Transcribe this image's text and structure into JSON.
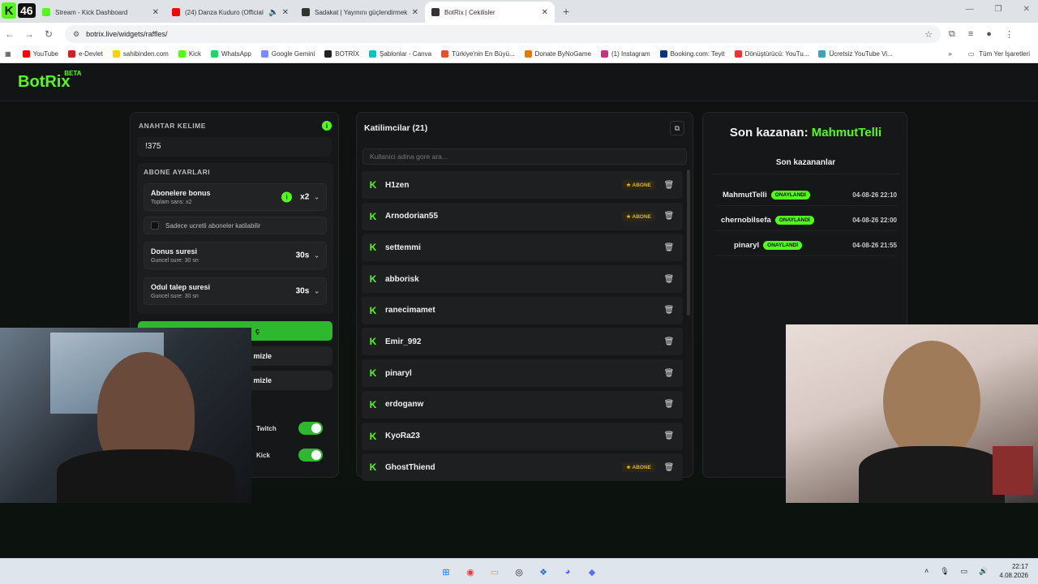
{
  "browser": {
    "badge_number": "46",
    "tabs": [
      {
        "title": "Stream - Kick Dashboard",
        "color": "#53fc18"
      },
      {
        "title": "(24) Danza Kuduro (Official",
        "color": "#ff0000"
      },
      {
        "title": "Sadakat | Yayınını güçlendirmek",
        "color": "#333333"
      },
      {
        "title": "BotRix | Cekilisler",
        "color": "#333333"
      }
    ],
    "url": "botrix.live/widgets/raffles/",
    "bookmarks": [
      {
        "label": "YouTube",
        "color": "#ff0000"
      },
      {
        "label": "e-Devlet",
        "color": "#cc2222"
      },
      {
        "label": "sahibinden.com",
        "color": "#ffd200"
      },
      {
        "label": "Kick",
        "color": "#53fc18"
      },
      {
        "label": "WhatsApp",
        "color": "#25d366"
      },
      {
        "label": "Google Gemini",
        "color": "#7b8cff"
      },
      {
        "label": "BOTRİX",
        "color": "#222222"
      },
      {
        "label": "Şablonlar - Canva",
        "color": "#00c4cc"
      },
      {
        "label": "Türkiye'nin En Büyü...",
        "color": "#e0532b"
      },
      {
        "label": "Donate ByNoGame",
        "color": "#e07b00"
      },
      {
        "label": "(1) Instagram",
        "color": "#c13584"
      },
      {
        "label": "Booking.com: Teyit",
        "color": "#003580"
      },
      {
        "label": "Dönüştürücü: YouTu...",
        "color": "#e53935"
      },
      {
        "label": "Ücretsiz YouTube Vi...",
        "color": "#3fa1b5"
      }
    ],
    "all_bookmarks": "Tüm Yer İşaretleri"
  },
  "app": {
    "brand": "BotRix",
    "brand_tag": "BETA"
  },
  "settings": {
    "keyword_label": "ANAHTAR KELIME",
    "keyword_value": "!375",
    "sub_settings_label": "ABONE AYARLARI",
    "sub_bonus_title": "Abonelere bonus",
    "sub_bonus_sub": "Toplam sans: x2",
    "sub_bonus_value": "x2",
    "sub_only_label": "Sadece ucretli aboneler katilabilir",
    "duration_title": "Donus suresi",
    "duration_sub": "Guncel sure: 30 sn",
    "duration_value": "30s",
    "claim_title": "Odul talep suresi",
    "claim_sub": "Guncel sure: 30 sn",
    "claim_value": "30s",
    "primary_button": "ç",
    "button_2": "mizle",
    "button_3": "mizle",
    "toggle_twitch": "Twitch",
    "toggle_kick": "Kick"
  },
  "participants": {
    "header": "Katilimcilar (21)",
    "search_placeholder": "Kullanici adina gore ara...",
    "badge_label": "ABONE",
    "list": [
      {
        "name": "H1zen",
        "sub": true
      },
      {
        "name": "Arnodorian55",
        "sub": true
      },
      {
        "name": "settemmi",
        "sub": false
      },
      {
        "name": "abborisk",
        "sub": false
      },
      {
        "name": "ranecimamet",
        "sub": false
      },
      {
        "name": "Emir_992",
        "sub": false
      },
      {
        "name": "pinaryl",
        "sub": false
      },
      {
        "name": "erdoganw",
        "sub": false
      },
      {
        "name": "KyoRa23",
        "sub": false
      },
      {
        "name": "GhostThiend",
        "sub": true
      }
    ]
  },
  "winners": {
    "last_label": "Son kazanan:",
    "last_name": "MahmutTelli",
    "list_header": "Son kazananlar",
    "badge_label": "ONAYLANDİ",
    "list": [
      {
        "name": "MahmutTelli",
        "date": "04-08-26 22:10"
      },
      {
        "name": "chernobilsefa",
        "date": "04-08-26 22:00"
      },
      {
        "name": "pinaryl",
        "date": "04-08-26 21:55"
      }
    ]
  },
  "taskbar": {
    "time": "22:17",
    "date": "4.08.2026"
  }
}
